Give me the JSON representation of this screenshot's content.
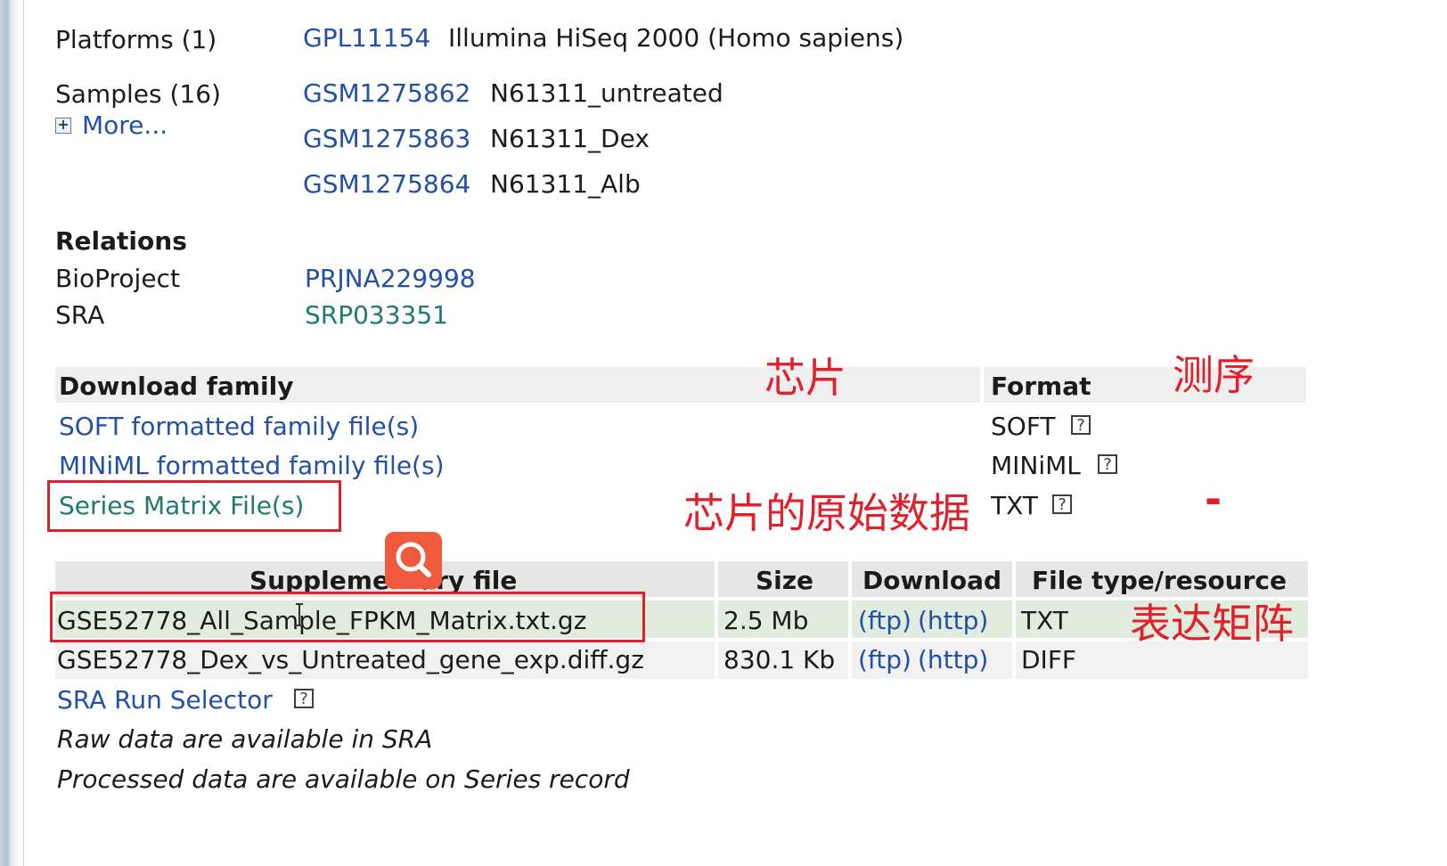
{
  "platforms": {
    "label": "Platforms (1)",
    "items": [
      {
        "id": "GPL11154",
        "desc": "Illumina HiSeq 2000 (Homo sapiens)"
      }
    ]
  },
  "samples": {
    "label": "Samples (16)",
    "more_label": "More...",
    "items": [
      {
        "id": "GSM1275862",
        "desc": "N61311_untreated"
      },
      {
        "id": "GSM1275863",
        "desc": "N61311_Dex"
      },
      {
        "id": "GSM1275864",
        "desc": "N61311_Alb"
      }
    ]
  },
  "relations": {
    "title": "Relations",
    "items": [
      {
        "label": "BioProject",
        "value": "PRJNA229998"
      },
      {
        "label": "SRA",
        "value": "SRP033351"
      }
    ]
  },
  "download_family": {
    "header": "Download family",
    "format_header": "Format",
    "rows": [
      {
        "link": "SOFT formatted family file(s)",
        "format": "SOFT"
      },
      {
        "link": "MINiML formatted family file(s)",
        "format": "MINiML"
      },
      {
        "link": "Series Matrix File(s)",
        "format": "TXT"
      }
    ],
    "help_glyph": "?"
  },
  "supplementary": {
    "headers": [
      "Supplementary file",
      "Size",
      "Download",
      "File type/resource"
    ],
    "rows": [
      {
        "file": "GSE52778_All_Sample_FPKM_Matrix.txt.gz",
        "size": "2.5 Mb",
        "ftp": "(ftp)",
        "http": "(http)",
        "type": "TXT"
      },
      {
        "file": "GSE52778_Dex_vs_Untreated_gene_exp.diff.gz",
        "size": "830.1 Kb",
        "ftp": "(ftp)",
        "http": "(http)",
        "type": "DIFF"
      }
    ]
  },
  "sra_run_selector": "SRA Run Selector",
  "notes": [
    "Raw data are available in SRA",
    "Processed data are available on Series record"
  ],
  "annotations": {
    "chip": "芯片",
    "sequencing": "测序",
    "chip_raw_data": "芯片的原始数据",
    "expression_matrix": "表达矩阵",
    "dash": "-"
  },
  "colors": {
    "link_blue": "#2150a5",
    "link_teal": "#1e7a73",
    "annotation_red": "#e0202a",
    "search_button": "#ef5a3c"
  }
}
